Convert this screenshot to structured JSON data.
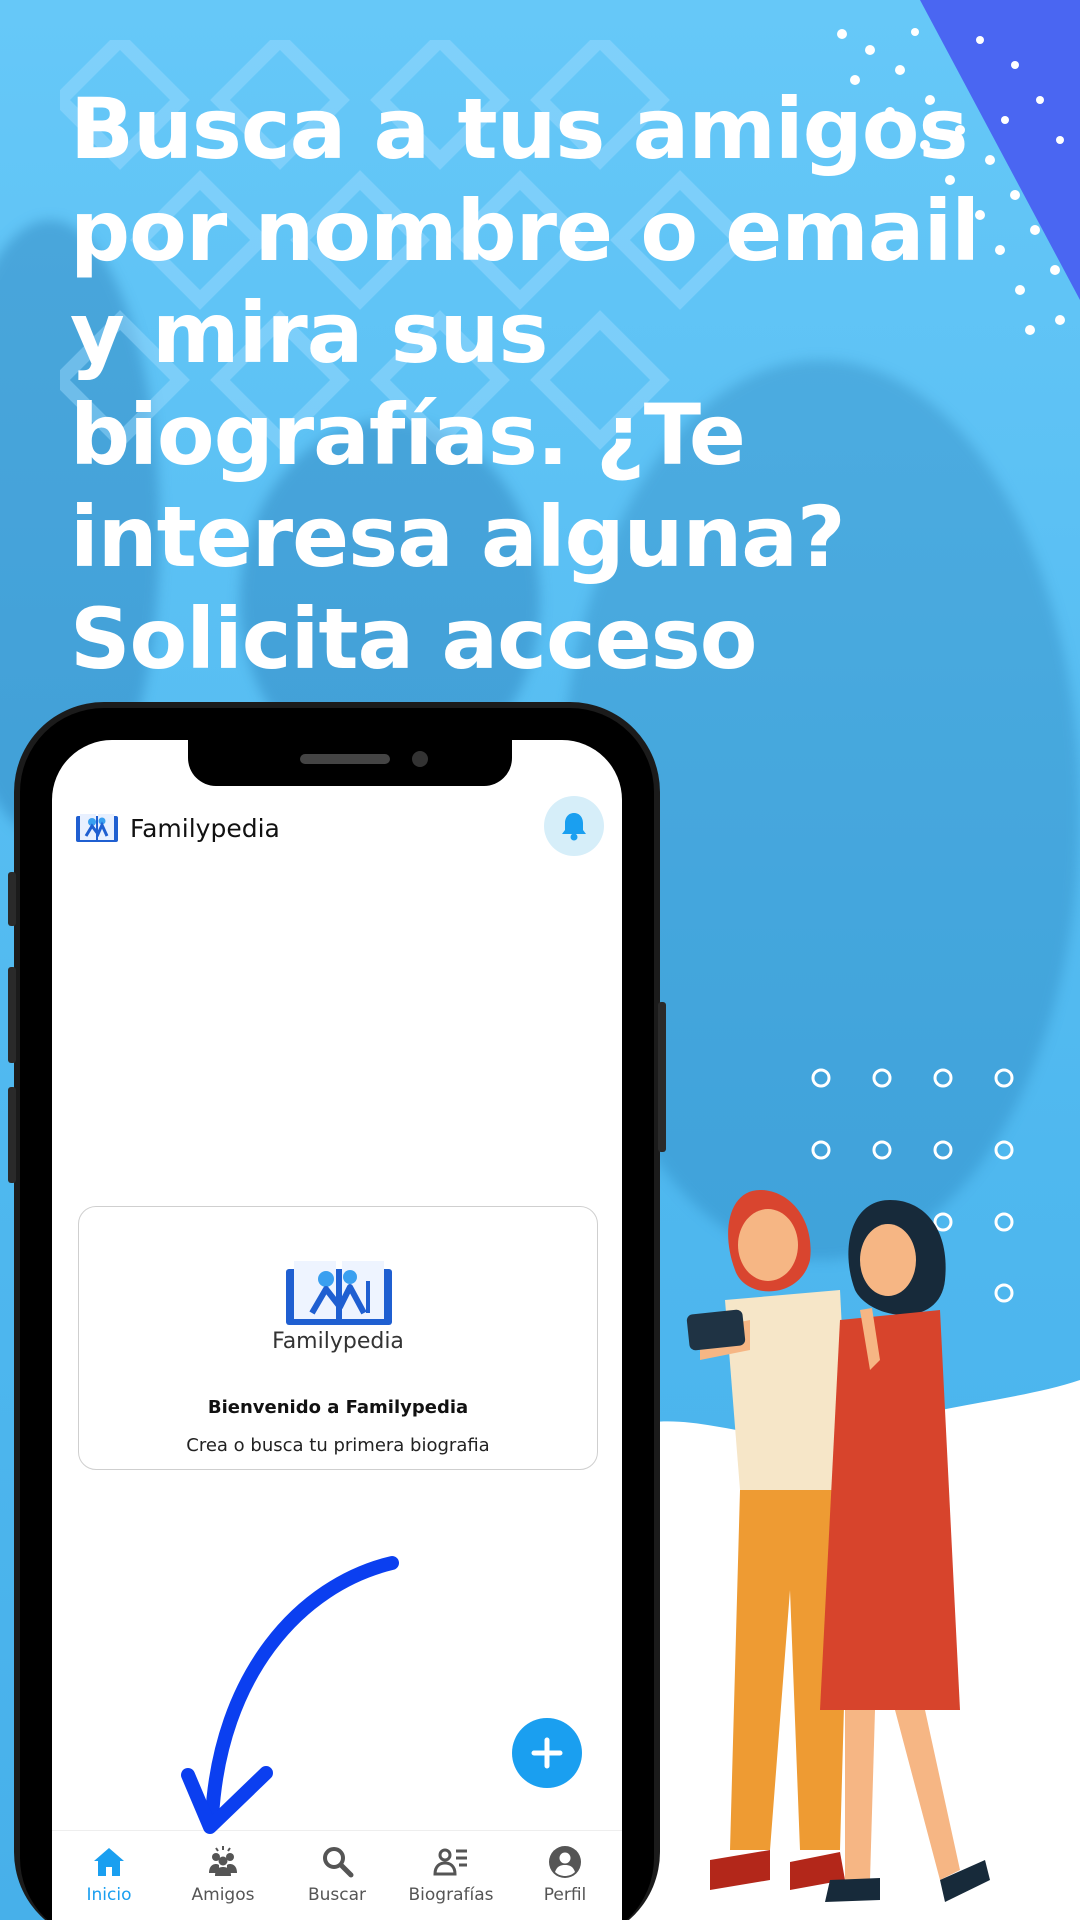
{
  "headline": {
    "lines": [
      "Busca a tus amigos",
      "por nombre o email",
      "y mira sus",
      "biografías. ¿Te",
      "interesa alguna?",
      "Solicita acceso"
    ]
  },
  "app": {
    "title": "Familypedia",
    "notifications_icon": "bell-icon",
    "welcome_card": {
      "brand": "Familypedia",
      "title": "Bienvenido a Familypedia",
      "subtitle": "Crea o busca tu primera biografia"
    },
    "fab_icon": "plus-icon",
    "bottom_nav": [
      {
        "label": "Inicio",
        "icon": "home-icon",
        "active": true
      },
      {
        "label": "Amigos",
        "icon": "friends-icon",
        "active": false
      },
      {
        "label": "Buscar",
        "icon": "search-icon",
        "active": false
      },
      {
        "label": "Biografías",
        "icon": "biographies-icon",
        "active": false
      },
      {
        "label": "Perfil",
        "icon": "profile-icon",
        "active": false
      }
    ]
  },
  "colors": {
    "accent": "#1a9ff0",
    "background": "#5ec3f5",
    "corner": "#4a66f2",
    "arrow": "#0b3ff0"
  }
}
